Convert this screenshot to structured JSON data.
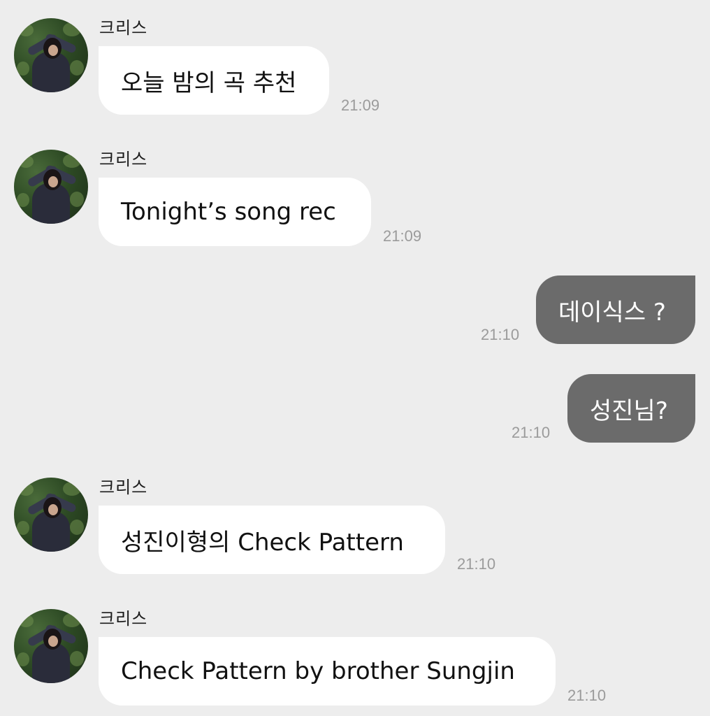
{
  "messages": [
    {
      "sender": "크리스",
      "text": "오늘 밤의 곡 추천",
      "time": "21:09",
      "direction": "incoming"
    },
    {
      "sender": "크리스",
      "text": "Tonight’s song rec",
      "time": "21:09",
      "direction": "incoming"
    },
    {
      "text": "데이식스 ?",
      "time": "21:10",
      "direction": "outgoing"
    },
    {
      "text": "성진님?",
      "time": "21:10",
      "direction": "outgoing"
    },
    {
      "sender": "크리스",
      "text": "성진이형의 Check Pattern",
      "time": "21:10",
      "direction": "incoming"
    },
    {
      "sender": "크리스",
      "text": "Check Pattern by brother Sungjin",
      "time": "21:10",
      "direction": "incoming"
    }
  ],
  "colors": {
    "background": "#ededed",
    "incoming_bubble": "#ffffff",
    "outgoing_bubble": "#6b6b6b",
    "timestamp": "#9b9b9b"
  }
}
